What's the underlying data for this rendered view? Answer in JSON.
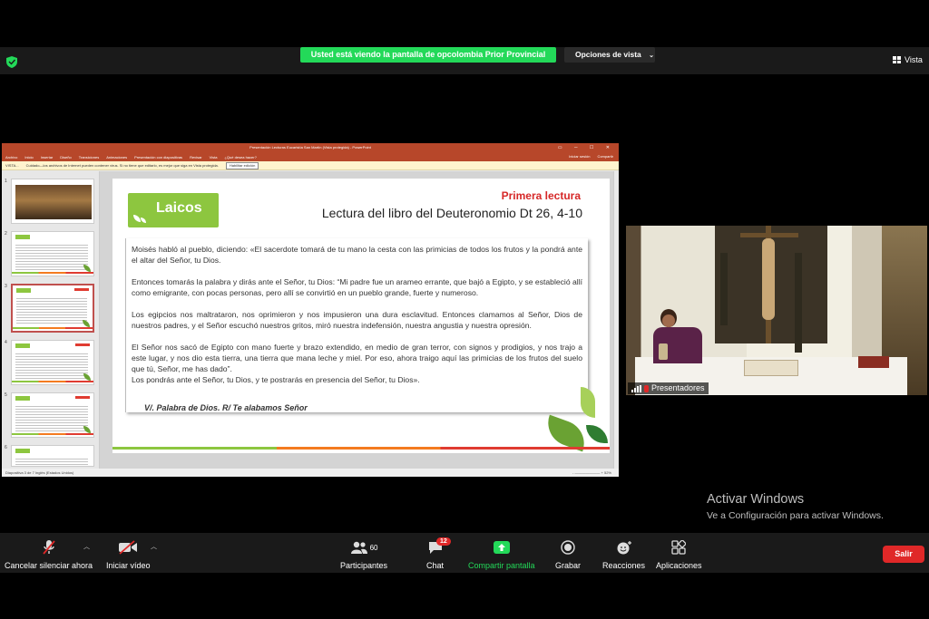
{
  "zoom": {
    "share_banner": "Usted está viendo la pantalla de opcolombia Prior Provincial",
    "view_options": "Opciones de vista",
    "vista": "Vista",
    "video_label": "Presentadores",
    "activate_title": "Activar Windows",
    "activate_sub": "Ve a Configuración para activar Windows.",
    "toolbar": {
      "mute": "Cancelar silenciar ahora",
      "video": "Iniciar vídeo",
      "participants": "Participantes",
      "participants_count": "60",
      "chat": "Chat",
      "chat_badge": "12",
      "share": "Compartir pantalla",
      "record": "Grabar",
      "reactions": "Reacciones",
      "apps": "Aplicaciones",
      "leave": "Salir"
    }
  },
  "ppt": {
    "title": "Presentación Lecturas Eucaristía San Martín (Vista protegida) - PowerPoint",
    "menu": [
      "Archivo",
      "Inicio",
      "Insertar",
      "Diseño",
      "Transiciones",
      "Animaciones",
      "Presentación con diapositivas",
      "Revisar",
      "Vista",
      "¿Qué desea hacer?"
    ],
    "menu_right": [
      "Iniciar sesión",
      "Compartir"
    ],
    "warning_label": "VISTA...",
    "warning_text": "Cuidado—los archivos de Internet pueden contener virus. Si no tiene que editarlo, es mejor que siga en Vista protegida.",
    "warning_button": "Habilitar edición",
    "thumb_numbers": [
      "1",
      "2",
      "3",
      "4",
      "5",
      "6"
    ],
    "status_left": "Diapositiva 3 de 7     Inglés (Estados Unidos)",
    "status_zoom": "- ——————— + 52%",
    "slide": {
      "logo": "Laicos",
      "heading": "Primera lectura",
      "title": "Lectura del libro del Deuteronomio Dt 26, 4-10",
      "paragraphs": [
        "Moisés habló al pueblo, diciendo: «El sacerdote tomará de tu mano la cesta con las primicias de todos los frutos y la pondrá ante el altar del Señor, tu Dios.",
        "Entonces tomarás la palabra y dirás ante el Señor, tu Dios: “Mi padre fue un arameo errante, que bajó a Egipto, y se estableció allí como emigrante, con pocas personas, pero allí se convirtió en un pueblo grande, fuerte y numeroso.",
        "Los egipcios nos maltrataron, nos oprimieron y nos impusieron una dura esclavitud. Entonces clamamos al Señor, Dios de nuestros padres, y el Señor escuchó nuestros gritos, miró nuestra indefensión, nuestra angustia y nuestra opresión.",
        "El Señor nos sacó de Egipto con mano fuerte y brazo extendido, en medio de gran terror, con signos y prodigios, y nos trajo a este lugar, y nos dio esta tierra, una tierra que mana leche y miel. Por eso, ahora traigo aquí las primicias de los frutos del suelo que tú, Señor, me has dado”.",
        "Los pondrás ante el Señor, tu Dios, y te postrarás en presencia del Señor, tu Dios»."
      ],
      "response": "V/. Palabra de Dios.  R/ Te alabamos Señor"
    }
  },
  "colors": {
    "zoom_green": "#23d959",
    "leave_red": "#e02828",
    "ppt_red": "#b7472a",
    "laicos_green": "#8dc63f",
    "heading_red": "#d62828"
  }
}
